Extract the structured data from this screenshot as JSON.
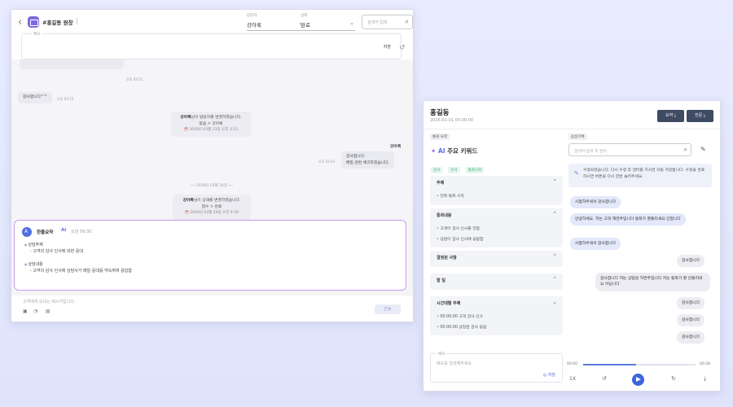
{
  "chat_window": {
    "back_glyph": "‹",
    "room_title": "#홍길동 원장",
    "assignee": {
      "label": "담당자",
      "value": "강아록"
    },
    "status": {
      "label": "상태",
      "value": "완료"
    },
    "search_placeholder": "검색어 입력",
    "memo": {
      "label": "메모",
      "save": "저장"
    },
    "messages": [
      {
        "text": "감사합니다^^",
        "time": "오후 03:15"
      }
    ],
    "top_time": "오후 03:11",
    "system_1": {
      "name": "강아록",
      "text": "님이 담당자를 변경하였습니다.",
      "change": "없음 > 강아록",
      "stamp": "2026년 03월 23일 오후 3:13"
    },
    "agent_tag": "강아록",
    "agent_message": {
      "line1": "감사합니다.",
      "line2": "메일 관련 체크하겠습니다.",
      "time": "오후 03:14"
    },
    "date_separator": "── 2026년 03월 24일 ──",
    "system_2": {
      "name": "강아록",
      "text": "님이 상태를 변경하였습니다.",
      "change": "접수 > 완료",
      "stamp": "2026년 03월 24일 오전 9:30"
    },
    "ai_summary": {
      "title": "한줄요약",
      "badge": "AI",
      "time": "오전 09:30",
      "topic_head": "상담주제",
      "topic_item": "- 고객의 감사 인사에 대한 응대",
      "content_head": "상담내용",
      "content_item": "- 고객의 감사 인사에 상담사가 메일 응대를 약속하며 응답함"
    },
    "compose_placeholder": "고객에게 보내는 메시지입니다.",
    "send_label": "전송"
  },
  "call_window": {
    "customer_name": "홍길동",
    "call_date": "2026-01-01 00:00:00",
    "download_summary": "요약 ⤓",
    "download_full": "전문 ⤓",
    "summary_section_label": "통화 요약",
    "transcript_section_label": "음성기록",
    "keyword_title_ai": "AI",
    "keyword_title_text": "주요 키워드",
    "tags": [
      "감사",
      "인사",
      "통화시작"
    ],
    "sections": [
      {
        "title": "주제",
        "items": [
          "전화 통화 시작"
        ]
      },
      {
        "title": "통화내용",
        "items": [
          "고객이 감사 인사를 전함",
          "상담이 감사 인사에 응답함"
        ]
      },
      {
        "title": "결정된 사항",
        "items": []
      },
      {
        "title": "할 일",
        "items": []
      },
      {
        "title": "시간대별 주제",
        "items": [
          "00:00:00 고객 감사 인사",
          "00:00:00 상담원 감사 응답"
        ]
      }
    ],
    "memo": {
      "label": "메모",
      "placeholder": "메모를 입력해주세요",
      "save": "저장"
    },
    "search_placeholder": "검색어 입력 후 엔터",
    "notice": "수정되었습니다. 다시 수정 후 엔터를 치시면 자동 저장됩니다. 수정을 완료하시면 버튼을 다시 한번 눌러주세요.",
    "transcript": [
      {
        "side": "l",
        "text": "시험하주세서 감사합니다"
      },
      {
        "side": "l",
        "text": "안녕하세요. 저는 고객 해면주입니다 통화가 잘들리세요 단합니다"
      },
      {
        "side": "l",
        "text": "시험하주세서 감사합니다"
      },
      {
        "side": "r",
        "text": "감사합니다"
      },
      {
        "side": "r",
        "text": "감사합니다 저는 상담원 허면주입니다 저는 통화가 잘 안들리네요 아닙니다"
      },
      {
        "side": "r",
        "text": "감사합니다"
      },
      {
        "side": "r",
        "text": "감사합니다"
      },
      {
        "side": "r",
        "text": "감사합니다"
      }
    ],
    "player": {
      "current": "00:00",
      "total": "00:38",
      "speed": "1X",
      "progress": 0.47
    }
  }
}
